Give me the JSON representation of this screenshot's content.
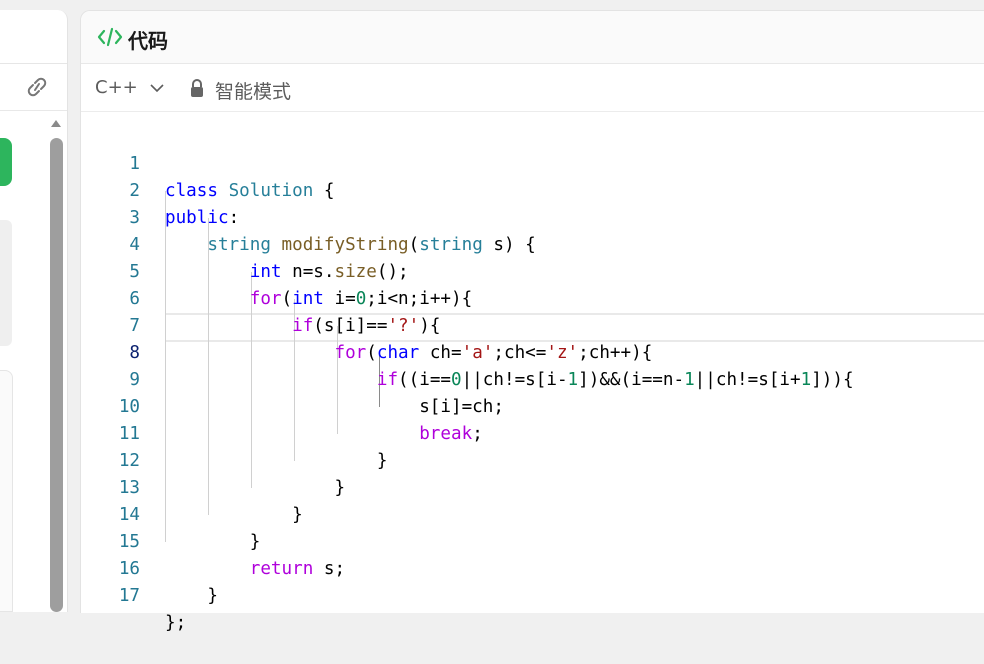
{
  "left_panel": {
    "link_icon": "link-icon"
  },
  "editor": {
    "title": "代码",
    "title_icon": "code-icon",
    "language": "C++",
    "mode_label": "智能模式",
    "mode_icon": "lock-icon",
    "current_line": 8,
    "lines": [
      {
        "n": "1"
      },
      {
        "n": "2"
      },
      {
        "n": "3"
      },
      {
        "n": "4"
      },
      {
        "n": "5"
      },
      {
        "n": "6"
      },
      {
        "n": "7"
      },
      {
        "n": "8"
      },
      {
        "n": "9"
      },
      {
        "n": "10"
      },
      {
        "n": "11"
      },
      {
        "n": "12"
      },
      {
        "n": "13"
      },
      {
        "n": "14"
      },
      {
        "n": "15"
      },
      {
        "n": "16"
      },
      {
        "n": "17"
      }
    ]
  },
  "colors": {
    "keyword": "#0000ff",
    "type": "#267f99",
    "function": "#795e26",
    "control": "#af00db",
    "number": "#098658",
    "string": "#a31515",
    "line_number": "#237893",
    "accent_green": "#2db55d"
  }
}
